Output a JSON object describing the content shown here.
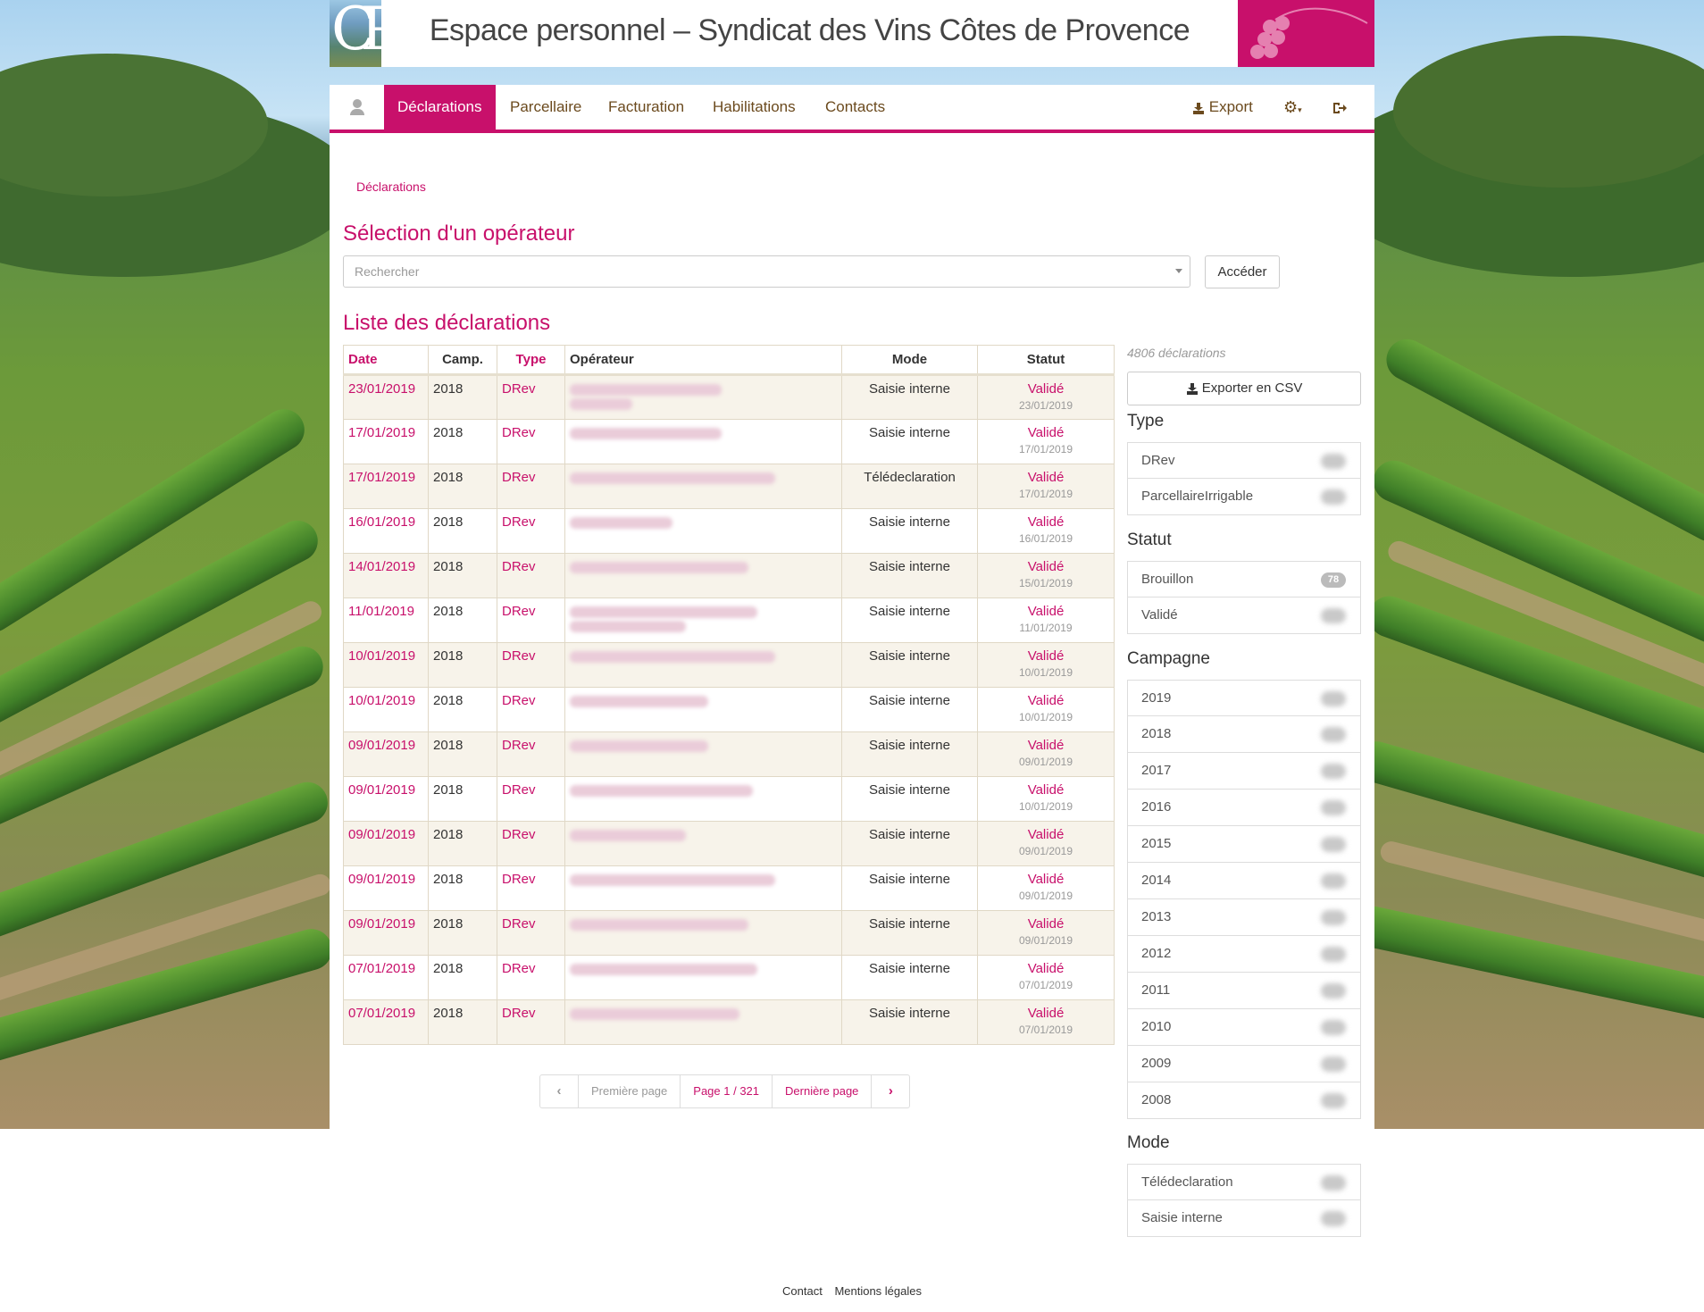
{
  "header": {
    "title": "Espace personnel – Syndicat des Vins Côtes de Provence",
    "logo_text": "CP"
  },
  "nav": {
    "items": [
      {
        "label": "Déclarations"
      },
      {
        "label": "Parcellaire"
      },
      {
        "label": "Facturation"
      },
      {
        "label": "Habilitations"
      },
      {
        "label": "Contacts"
      }
    ],
    "export_label": "Export",
    "active_color": "#c8106b"
  },
  "breadcrumb": "Déclarations",
  "operator": {
    "heading": "Sélection d'un opérateur",
    "placeholder": "Rechercher",
    "button": "Accéder"
  },
  "declarations": {
    "heading": "Liste des déclarations",
    "columns": {
      "date": "Date",
      "camp": "Camp.",
      "type": "Type",
      "operateur": "Opérateur",
      "mode": "Mode",
      "statut": "Statut"
    },
    "rows": [
      {
        "date": "23/01/2019",
        "camp": "2018",
        "type": "DRev",
        "mode": "Saisie interne",
        "statut": "Validé",
        "statut_date": "23/01/2019"
      },
      {
        "date": "17/01/2019",
        "camp": "2018",
        "type": "DRev",
        "mode": "Saisie interne",
        "statut": "Validé",
        "statut_date": "17/01/2019"
      },
      {
        "date": "17/01/2019",
        "camp": "2018",
        "type": "DRev",
        "mode": "Télédeclaration",
        "statut": "Validé",
        "statut_date": "17/01/2019"
      },
      {
        "date": "16/01/2019",
        "camp": "2018",
        "type": "DRev",
        "mode": "Saisie interne",
        "statut": "Validé",
        "statut_date": "16/01/2019"
      },
      {
        "date": "14/01/2019",
        "camp": "2018",
        "type": "DRev",
        "mode": "Saisie interne",
        "statut": "Validé",
        "statut_date": "15/01/2019"
      },
      {
        "date": "11/01/2019",
        "camp": "2018",
        "type": "DRev",
        "mode": "Saisie interne",
        "statut": "Validé",
        "statut_date": "11/01/2019"
      },
      {
        "date": "10/01/2019",
        "camp": "2018",
        "type": "DRev",
        "mode": "Saisie interne",
        "statut": "Validé",
        "statut_date": "10/01/2019"
      },
      {
        "date": "10/01/2019",
        "camp": "2018",
        "type": "DRev",
        "mode": "Saisie interne",
        "statut": "Validé",
        "statut_date": "10/01/2019"
      },
      {
        "date": "09/01/2019",
        "camp": "2018",
        "type": "DRev",
        "mode": "Saisie interne",
        "statut": "Validé",
        "statut_date": "09/01/2019"
      },
      {
        "date": "09/01/2019",
        "camp": "2018",
        "type": "DRev",
        "mode": "Saisie interne",
        "statut": "Validé",
        "statut_date": "10/01/2019"
      },
      {
        "date": "09/01/2019",
        "camp": "2018",
        "type": "DRev",
        "mode": "Saisie interne",
        "statut": "Validé",
        "statut_date": "09/01/2019"
      },
      {
        "date": "09/01/2019",
        "camp": "2018",
        "type": "DRev",
        "mode": "Saisie interne",
        "statut": "Validé",
        "statut_date": "09/01/2019"
      },
      {
        "date": "09/01/2019",
        "camp": "2018",
        "type": "DRev",
        "mode": "Saisie interne",
        "statut": "Validé",
        "statut_date": "09/01/2019"
      },
      {
        "date": "07/01/2019",
        "camp": "2018",
        "type": "DRev",
        "mode": "Saisie interne",
        "statut": "Validé",
        "statut_date": "07/01/2019"
      },
      {
        "date": "07/01/2019",
        "camp": "2018",
        "type": "DRev",
        "mode": "Saisie interne",
        "statut": "Validé",
        "statut_date": "07/01/2019"
      }
    ]
  },
  "pagination": {
    "first": "Première page",
    "current": "Page 1 / 321",
    "last": "Dernière page"
  },
  "sidebar": {
    "count": "4806 déclarations",
    "export_csv": "Exporter en CSV",
    "facets": {
      "type": {
        "title": "Type",
        "items": [
          {
            "label": "DRev"
          },
          {
            "label": "ParcellaireIrrigable"
          }
        ]
      },
      "statut": {
        "title": "Statut",
        "items": [
          {
            "label": "Brouillon",
            "count": "78"
          },
          {
            "label": "Validé"
          }
        ]
      },
      "campagne": {
        "title": "Campagne",
        "items": [
          {
            "label": "2019"
          },
          {
            "label": "2018"
          },
          {
            "label": "2017"
          },
          {
            "label": "2016"
          },
          {
            "label": "2015"
          },
          {
            "label": "2014"
          },
          {
            "label": "2013"
          },
          {
            "label": "2012"
          },
          {
            "label": "2011"
          },
          {
            "label": "2010"
          },
          {
            "label": "2009"
          },
          {
            "label": "2008"
          }
        ]
      },
      "mode": {
        "title": "Mode",
        "items": [
          {
            "label": "Télédeclaration"
          },
          {
            "label": "Saisie interne"
          }
        ]
      }
    }
  },
  "footer": {
    "contact": "Contact",
    "mentions": "Mentions légales"
  }
}
